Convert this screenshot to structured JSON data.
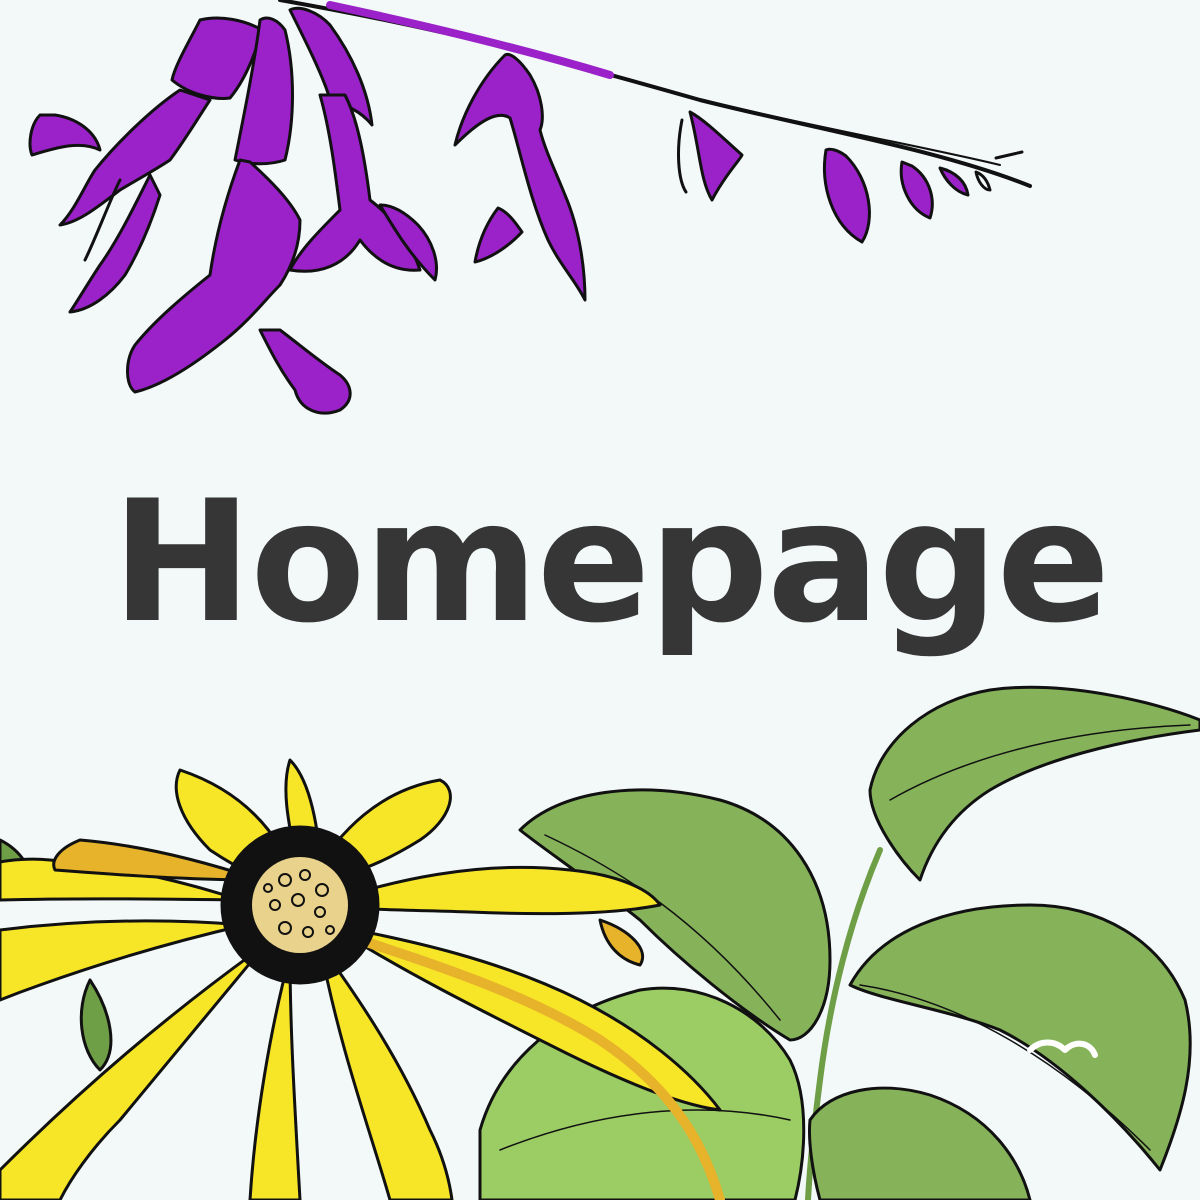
{
  "page": {
    "title": "Homepage",
    "background_color": "#f3f8f9",
    "title_color": "#363636"
  },
  "illustrations": {
    "top": {
      "icon": "purple-salvia-flower-icon",
      "colors": [
        "#9a22c8",
        "#b64adf",
        "#111111"
      ]
    },
    "bottom_left": {
      "icon": "yellow-black-eyed-susan-icon",
      "colors": [
        "#f7e528",
        "#e6b32a",
        "#111111",
        "#e9d28c"
      ]
    },
    "bottom_right": {
      "icon": "green-leaves-icon",
      "colors": [
        "#86b35a",
        "#6e9e45",
        "#9ccc64"
      ]
    }
  }
}
